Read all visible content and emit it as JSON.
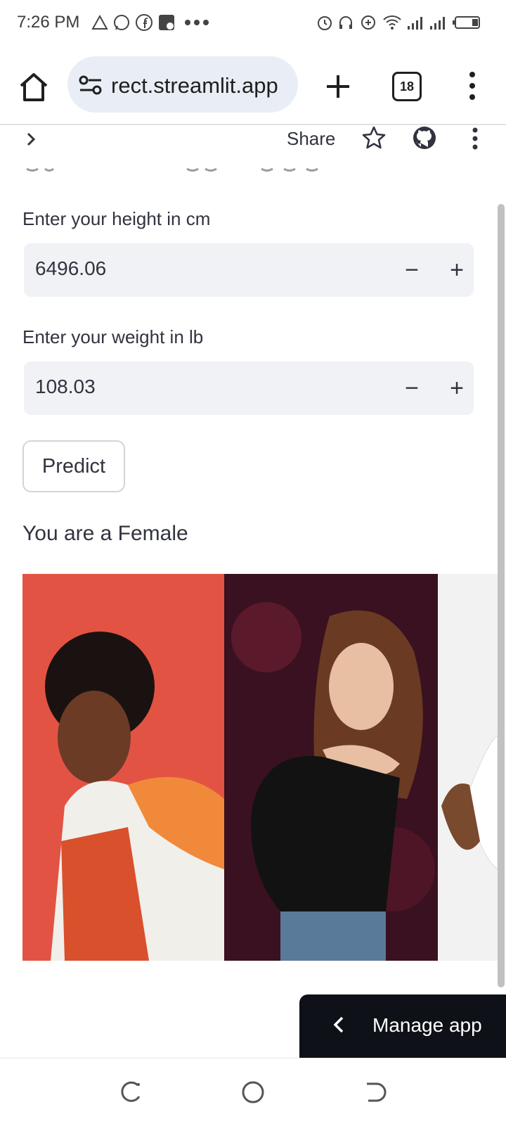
{
  "status_bar": {
    "time": "7:26 PM",
    "icons": [
      "alert-triangle-icon",
      "whatsapp-icon",
      "facebook-icon",
      "photo-icon",
      "more-dots-icon",
      "alarm-icon",
      "headphones-icon",
      "data-saver-icon",
      "wifi-icon",
      "signal-icon",
      "signal-icon",
      "battery-icon"
    ]
  },
  "browser": {
    "url": "rect.streamlit.app",
    "tab_count": "18"
  },
  "streamlit_header": {
    "share_label": "Share"
  },
  "form": {
    "height": {
      "label": "Enter your height in cm",
      "value": "6496.06",
      "minus": "−",
      "plus": "+"
    },
    "weight": {
      "label": "Enter your weight in lb",
      "value": "108.03",
      "minus": "−",
      "plus": "+"
    },
    "predict_label": "Predict"
  },
  "result_text": "You are a Female",
  "manage_app_label": "Manage app",
  "colors": {
    "accent_dark": "#0e1117",
    "input_bg": "#f0f2f6",
    "url_bg": "#e9eef6",
    "text": "#31333f"
  }
}
